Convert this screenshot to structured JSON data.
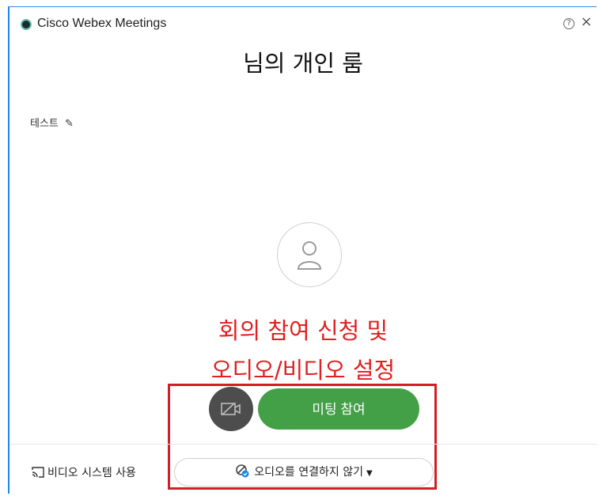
{
  "window": {
    "title": "Cisco Webex Meetings"
  },
  "room": {
    "title": "님의 개인 룸",
    "host_label": "테스트"
  },
  "annotation": {
    "line1": "회의 참여 신청 및",
    "line2": "오디오/비디오 설정",
    "color": "#e02020"
  },
  "actions": {
    "join_label": "미팅 참여",
    "join_color": "#43a047",
    "video_system_label": "비디오 시스템 사용",
    "audio_label": "오디오를 연결하지 않기"
  },
  "icons": {
    "logo": "webex-logo-icon",
    "help": "help-icon",
    "close": "close-icon",
    "edit": "pencil-icon",
    "avatar": "user-avatar-icon",
    "video": "video-off-icon",
    "cast": "cast-icon",
    "audio": "audio-off-icon",
    "dropdown": "caret-down-icon"
  }
}
